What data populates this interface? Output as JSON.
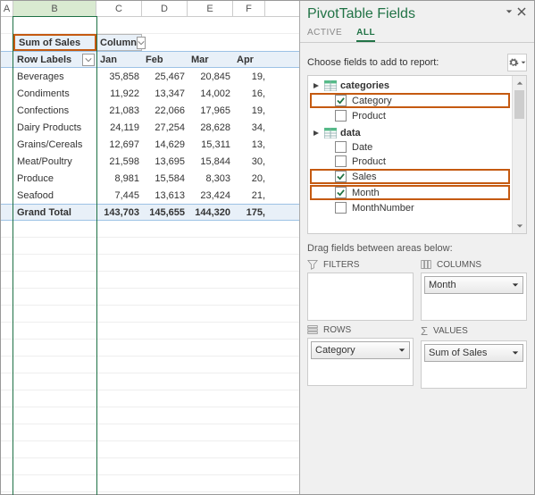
{
  "grid": {
    "columns": [
      "A",
      "B",
      "C",
      "D",
      "E",
      "F"
    ],
    "selected_column": "B",
    "title_cell": "Sum of Sales",
    "column_labels_cell": "Column",
    "row_labels_cell": "Row Labels",
    "months": [
      "Jan",
      "Feb",
      "Mar",
      "Apr"
    ],
    "rows": [
      {
        "label": "Beverages",
        "v": [
          "35,858",
          "25,467",
          "20,845",
          "19,"
        ]
      },
      {
        "label": "Condiments",
        "v": [
          "11,922",
          "13,347",
          "14,002",
          "16,"
        ]
      },
      {
        "label": "Confections",
        "v": [
          "21,083",
          "22,066",
          "17,965",
          "19,"
        ]
      },
      {
        "label": "Dairy Products",
        "v": [
          "24,119",
          "27,254",
          "28,628",
          "34,"
        ]
      },
      {
        "label": "Grains/Cereals",
        "v": [
          "12,697",
          "14,629",
          "15,311",
          "13,"
        ]
      },
      {
        "label": "Meat/Poultry",
        "v": [
          "21,598",
          "13,695",
          "15,844",
          "30,"
        ]
      },
      {
        "label": "Produce",
        "v": [
          "8,981",
          "15,584",
          "8,303",
          "20,"
        ]
      },
      {
        "label": "Seafood",
        "v": [
          "7,445",
          "13,613",
          "23,424",
          "21,"
        ]
      }
    ],
    "grand_total_label": "Grand Total",
    "grand_total": [
      "143,703",
      "145,655",
      "144,320",
      "175,"
    ]
  },
  "pane": {
    "title": "PivotTable Fields",
    "tabs": {
      "active": "ACTIVE",
      "all": "ALL"
    },
    "choose_label": "Choose fields to add to report:",
    "tables": [
      {
        "name": "categories",
        "fields": [
          {
            "label": "Category",
            "checked": true,
            "hl": true
          },
          {
            "label": "Product",
            "checked": false,
            "hl": false
          }
        ]
      },
      {
        "name": "data",
        "fields": [
          {
            "label": "Date",
            "checked": false,
            "hl": false
          },
          {
            "label": "Product",
            "checked": false,
            "hl": false
          },
          {
            "label": "Sales",
            "checked": true,
            "hl": true
          },
          {
            "label": "Month",
            "checked": true,
            "hl": true
          },
          {
            "label": "MonthNumber",
            "checked": false,
            "hl": false
          }
        ]
      }
    ],
    "drag_label": "Drag fields between areas below:",
    "areas": {
      "filters": {
        "label": "FILTERS",
        "items": []
      },
      "columns": {
        "label": "COLUMNS",
        "items": [
          "Month"
        ]
      },
      "rows": {
        "label": "ROWS",
        "items": [
          "Category"
        ]
      },
      "values": {
        "label": "VALUES",
        "items": [
          "Sum of Sales"
        ]
      }
    }
  },
  "chart_data": {
    "type": "table",
    "title": "Sum of Sales",
    "categories": [
      "Beverages",
      "Condiments",
      "Confections",
      "Dairy Products",
      "Grains/Cereals",
      "Meat/Poultry",
      "Produce",
      "Seafood",
      "Grand Total"
    ],
    "series": [
      {
        "name": "Jan",
        "values": [
          35858,
          11922,
          21083,
          24119,
          12697,
          21598,
          8981,
          7445,
          143703
        ]
      },
      {
        "name": "Feb",
        "values": [
          25467,
          13347,
          22066,
          27254,
          14629,
          13695,
          15584,
          13613,
          145655
        ]
      },
      {
        "name": "Mar",
        "values": [
          20845,
          14002,
          17965,
          28628,
          15311,
          15844,
          8303,
          23424,
          144320
        ]
      }
    ]
  }
}
